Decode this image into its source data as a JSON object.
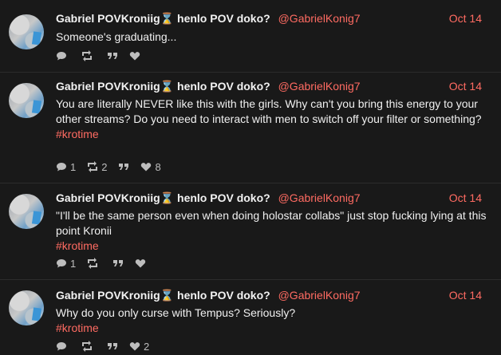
{
  "posts": [
    {
      "name": "Gabriel POVKroniig",
      "status_icon": "hourglass-icon",
      "display_suffix": "henlo POV doko?",
      "handle": "@GabrielKonig7",
      "date": "Oct 14",
      "text": "Someone's graduating...",
      "hashtag": "",
      "replies": "",
      "retweets": "",
      "likes": ""
    },
    {
      "name": "Gabriel POVKroniig",
      "status_icon": "hourglass-icon",
      "display_suffix": "henlo POV doko?",
      "handle": "@GabrielKonig7",
      "date": "Oct 14",
      "text": "You are literally NEVER like this with the girls. Why can't you bring this energy to your other streams? Do you need to interact with men to switch off your filter or something?",
      "hashtag": "#krotime",
      "replies": "1",
      "retweets": "2",
      "likes": "8"
    },
    {
      "name": "Gabriel POVKroniig",
      "status_icon": "hourglass-icon",
      "display_suffix": "henlo POV doko?",
      "handle": "@GabrielKonig7",
      "date": "Oct 14",
      "text": "\"I'll be the same person even when doing holostar collabs\" just stop fucking lying at this point Kronii",
      "hashtag": "#krotime",
      "replies": "1",
      "retweets": "",
      "likes": ""
    },
    {
      "name": "Gabriel POVKroniig",
      "status_icon": "hourglass-icon",
      "display_suffix": "henlo POV doko?",
      "handle": "@GabrielKonig7",
      "date": "Oct 14",
      "text": "Why do you only curse with Tempus? Seriously?",
      "hashtag": "#krotime",
      "replies": "",
      "retweets": "",
      "likes": "2"
    }
  ],
  "colors": {
    "background": "#191919",
    "accent": "#ff6b62",
    "hourglass": "#f0a830"
  }
}
